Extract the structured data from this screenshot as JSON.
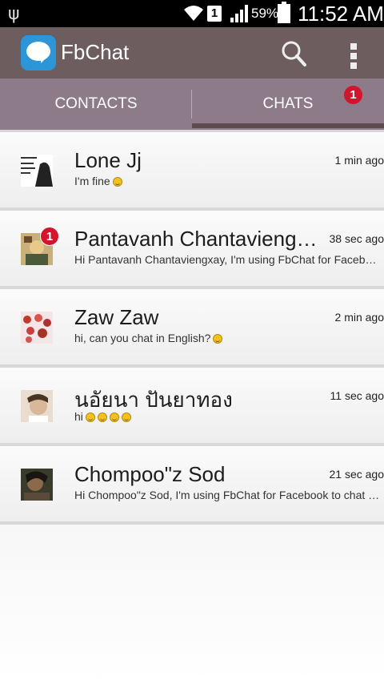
{
  "status_bar": {
    "battery_percent": "59%",
    "time": "11:52 AM",
    "sim_label": "1",
    "icons": [
      "usb-icon",
      "wifi-icon",
      "sim-icon",
      "signal-icon",
      "battery-charging-icon"
    ]
  },
  "app_bar": {
    "title": "FbChat",
    "logo_icon": "chat-bubble-icon",
    "actions": [
      "search-icon",
      "overflow-menu-icon"
    ]
  },
  "tabs": {
    "items": [
      {
        "label": "CONTACTS",
        "selected": false
      },
      {
        "label": "CHATS",
        "selected": true
      }
    ],
    "chats_badge": "1"
  },
  "chats": [
    {
      "name": "Lone Jj",
      "time": "1 min ago",
      "message": "I'm fine",
      "emoji_count": 1,
      "badge": ""
    },
    {
      "name": "Pantavanh Chantaviengxay",
      "time": "38 sec ago",
      "message": "Hi Pantavanh Chantaviengxay, I'm using FbChat for Facebook to chat with you",
      "emoji_count": 0,
      "badge": "1"
    },
    {
      "name": "Zaw Zaw",
      "time": "2 min ago",
      "message": "hi, can you chat in English?",
      "emoji_count": 1,
      "badge": ""
    },
    {
      "name": "นอัยนา ปันยาทอง",
      "time": "11 sec ago",
      "message": "hi",
      "emoji_count": 4,
      "badge": ""
    },
    {
      "name": "Chompoo\"z Sod",
      "time": "21 sec ago",
      "message": "Hi Chompoo\"z Sod, I'm using FbChat for Facebook to chat with you",
      "emoji_count": 0,
      "badge": ""
    }
  ],
  "colors": {
    "app_bar": "#6e5d5f",
    "tab_bar": "#8d7b89",
    "tab_indicator": "#5e4b4f",
    "badge": "#d2142c",
    "logo": "#2d96d8"
  }
}
